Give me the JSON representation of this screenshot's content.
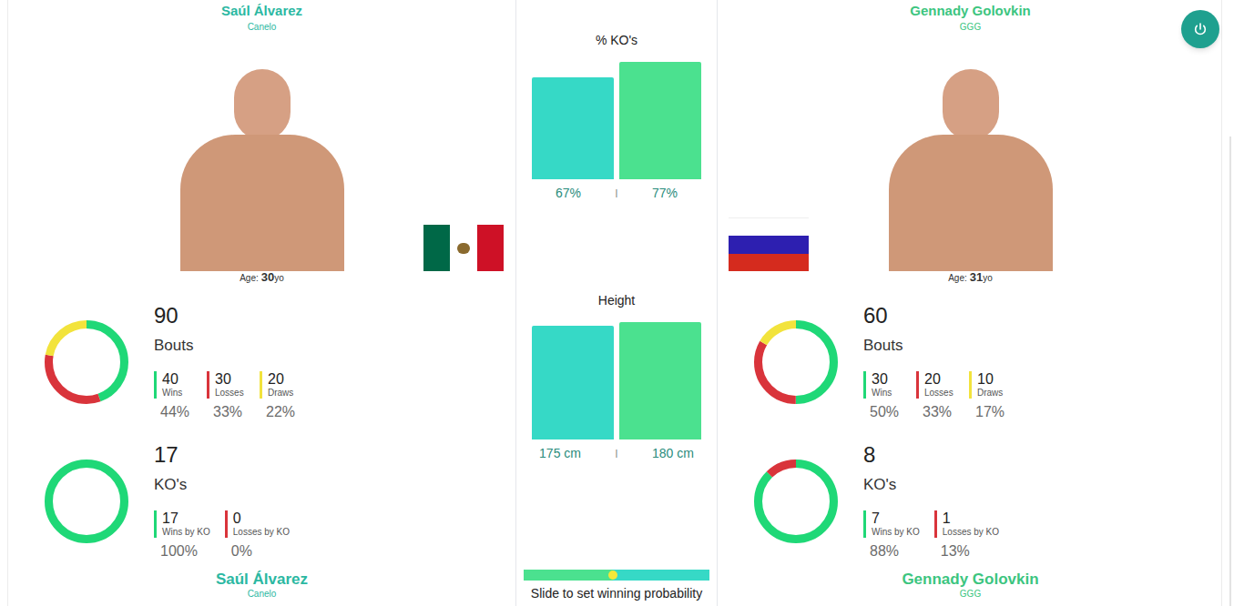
{
  "fighters": [
    {
      "name": "Saúl Álvarez",
      "nickname": "Canelo",
      "color": "#2bb8a2",
      "flag_kind": "mexico",
      "age_prefix": "Age:",
      "age": "30",
      "age_suffix": "yo",
      "bouts": {
        "total": "90",
        "label": "Bouts",
        "items": [
          {
            "value": "40",
            "label": "Wins",
            "percent": "44%",
            "color": "#1fd877"
          },
          {
            "value": "30",
            "label": "Losses",
            "percent": "33%",
            "color": "#d9343b"
          },
          {
            "value": "20",
            "label": "Draws",
            "percent": "22%",
            "color": "#f2e33c"
          }
        ]
      },
      "kos": {
        "total": "17",
        "label": "KO's",
        "items": [
          {
            "value": "17",
            "label": "Wins by KO",
            "percent": "100%",
            "color": "#1fd877"
          },
          {
            "value": "0",
            "label": "Losses by KO",
            "percent": "0%",
            "color": "#d9343b"
          }
        ]
      }
    },
    {
      "name": "Gennady Golovkin",
      "nickname": "GGG",
      "color": "#3cc57f",
      "flag_kind": "russia",
      "age_prefix": "Age:",
      "age": "31",
      "age_suffix": "yo",
      "bouts": {
        "total": "60",
        "label": "Bouts",
        "items": [
          {
            "value": "30",
            "label": "Wins",
            "percent": "50%",
            "color": "#1fd877"
          },
          {
            "value": "20",
            "label": "Losses",
            "percent": "33%",
            "color": "#d9343b"
          },
          {
            "value": "10",
            "label": "Draws",
            "percent": "17%",
            "color": "#f2e33c"
          }
        ]
      },
      "kos": {
        "total": "8",
        "label": "KO's",
        "items": [
          {
            "value": "7",
            "label": "Wins by KO",
            "percent": "88%",
            "color": "#1fd877"
          },
          {
            "value": "1",
            "label": "Losses by KO",
            "percent": "13%",
            "color": "#d9343b"
          }
        ]
      }
    }
  ],
  "comparisons": [
    {
      "title": "% KO's",
      "separator": "|",
      "series": [
        {
          "value": 67,
          "label": "67%",
          "color": "#36d9c6"
        },
        {
          "value": 77,
          "label": "77%",
          "color": "#4be18f"
        }
      ]
    },
    {
      "title": "Height",
      "separator": "|",
      "series": [
        {
          "value": 175,
          "label": "175 cm",
          "color": "#36d9c6"
        },
        {
          "value": 180,
          "label": "180 cm",
          "color": "#4be18f"
        }
      ]
    }
  ],
  "slider": {
    "level": 0.48,
    "label": "Slide to set winning probability"
  }
}
